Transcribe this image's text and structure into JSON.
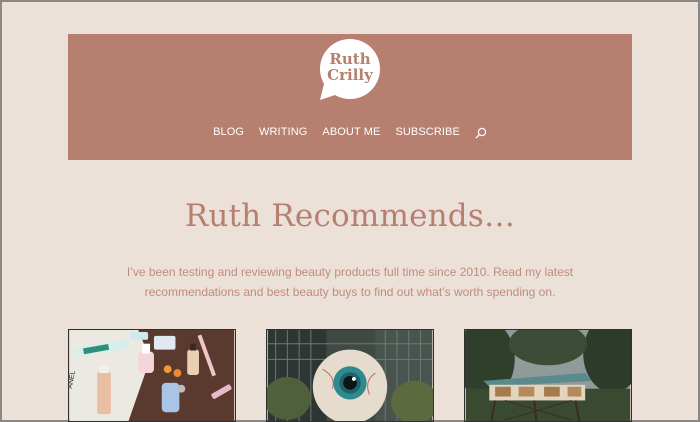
{
  "brand": {
    "logo_line1": "Ruth",
    "logo_line2": "Crilly"
  },
  "colors": {
    "header": "#b67f70",
    "background": "#ece1d9",
    "title": "#b67f70",
    "intro": "#bf8c7d"
  },
  "nav": {
    "items": [
      {
        "label": "BLOG"
      },
      {
        "label": "WRITING"
      },
      {
        "label": "ABOUT ME"
      },
      {
        "label": "SUBSCRIBE"
      }
    ],
    "search_icon": "search-icon"
  },
  "page": {
    "title": "Ruth Recommends…",
    "intro_line1": "I’ve been testing and reviewing beauty products full time since 2010. Read my latest",
    "intro_line2": "recommendations and best beauty buys to find out what’s worth spending on."
  },
  "cards": [
    {
      "image": "beauty-products-photo"
    },
    {
      "image": "giant-eyeball-sculpture-photo"
    },
    {
      "image": "treehouse-cabin-photo"
    }
  ]
}
